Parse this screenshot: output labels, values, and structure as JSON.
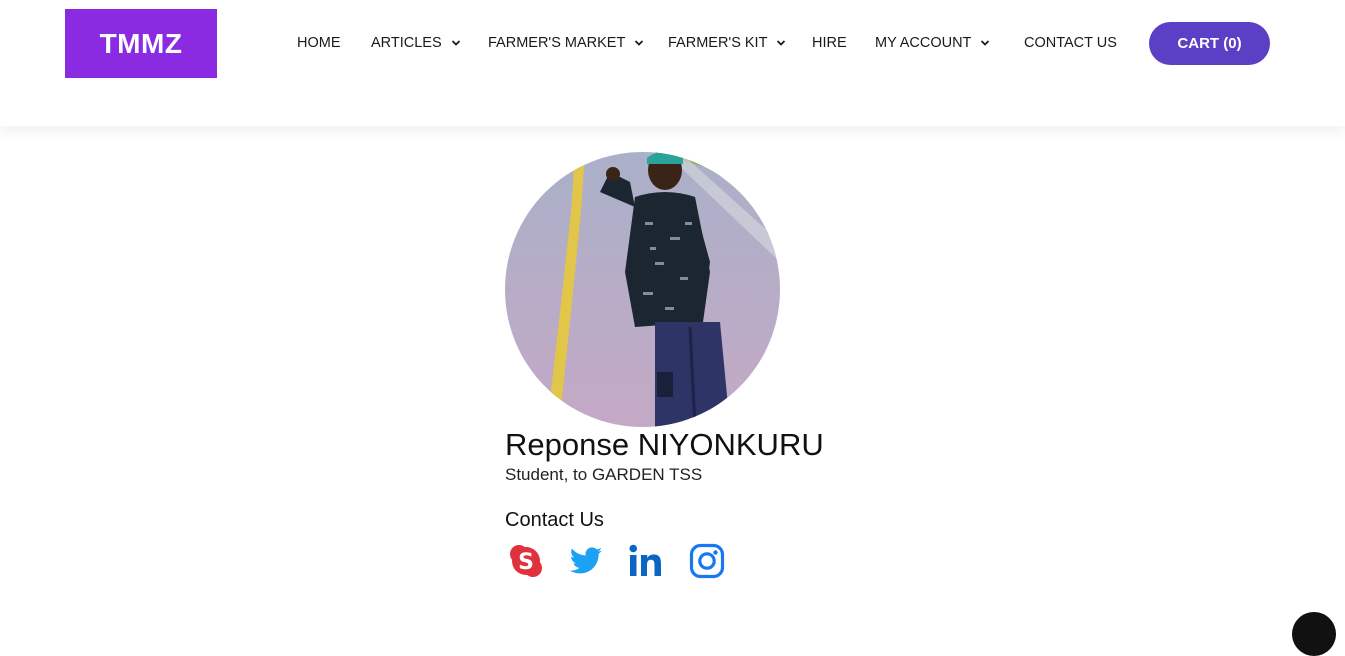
{
  "brand": {
    "logo_text": "TMMZ",
    "color": "#8a2be2"
  },
  "nav": {
    "items": [
      {
        "label": "HOME",
        "has_dropdown": false
      },
      {
        "label": "ARTICLES",
        "has_dropdown": true
      },
      {
        "label": "FARMER'S MARKET",
        "has_dropdown": true
      },
      {
        "label": "FARMER'S KIT",
        "has_dropdown": true
      },
      {
        "label": "HIRE",
        "has_dropdown": false
      },
      {
        "label": "MY ACCOUNT",
        "has_dropdown": true
      },
      {
        "label": "CONTACT US",
        "has_dropdown": false
      }
    ],
    "cart_label": "CART (0)",
    "cart_color": "#5b3fc4"
  },
  "profile": {
    "photo_icon": "profile-photo",
    "name": "Reponse NIYONKURU",
    "role": "Student, to GARDEN TSS",
    "contact_heading": "Contact Us",
    "social": [
      {
        "icon": "skype-icon",
        "color": "#e0323d"
      },
      {
        "icon": "twitter-icon",
        "color": "#1da1f2"
      },
      {
        "icon": "linkedin-icon",
        "color": "#0a66c2"
      },
      {
        "icon": "instagram-icon",
        "color": "#1877f2"
      }
    ]
  }
}
